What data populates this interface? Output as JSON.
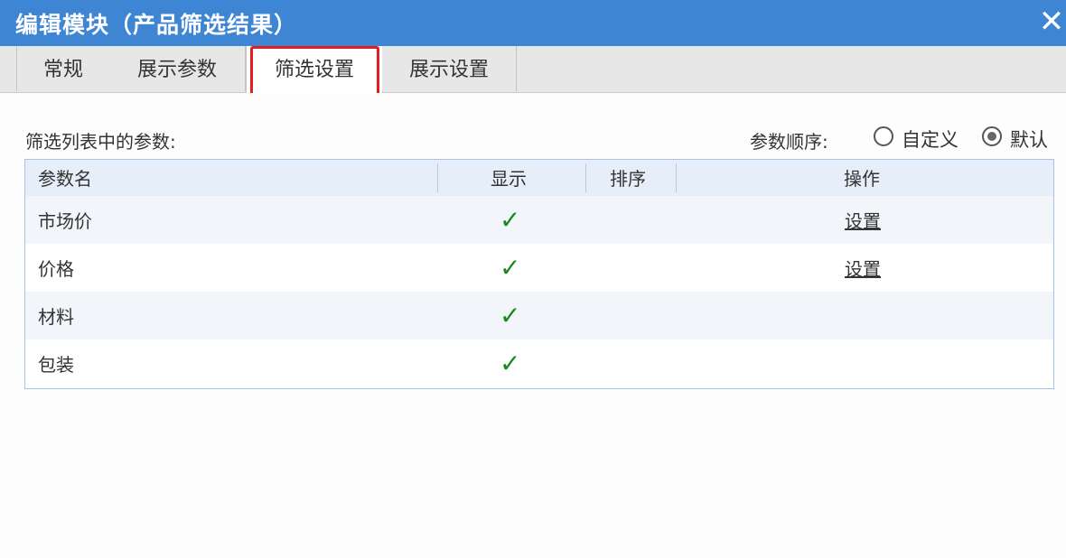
{
  "dialog": {
    "title": "编辑模块（产品筛选结果）",
    "close_glyph": "✕"
  },
  "tabs": [
    {
      "label": "常规"
    },
    {
      "label": "展示参数"
    },
    {
      "label": "筛选设置",
      "active": true
    },
    {
      "label": "展示设置"
    }
  ],
  "filter": {
    "list_label": "筛选列表中的参数:",
    "order_label": "参数顺序:",
    "order_options": [
      {
        "label": "自定义",
        "selected": false
      },
      {
        "label": "默认",
        "selected": true
      }
    ]
  },
  "table": {
    "columns": [
      "参数名",
      "显示",
      "排序",
      "操作"
    ],
    "rows": [
      {
        "name": "市场价",
        "show": "✓",
        "action": "设置"
      },
      {
        "name": "价格",
        "show": "✓",
        "action": "设置"
      },
      {
        "name": "材料",
        "show": "✓",
        "action": ""
      },
      {
        "name": "包装",
        "show": "✓",
        "action": ""
      }
    ]
  },
  "colors": {
    "titlebar": "#3e85d3",
    "highlight": "#e02020",
    "check": "#1a8a1a"
  }
}
